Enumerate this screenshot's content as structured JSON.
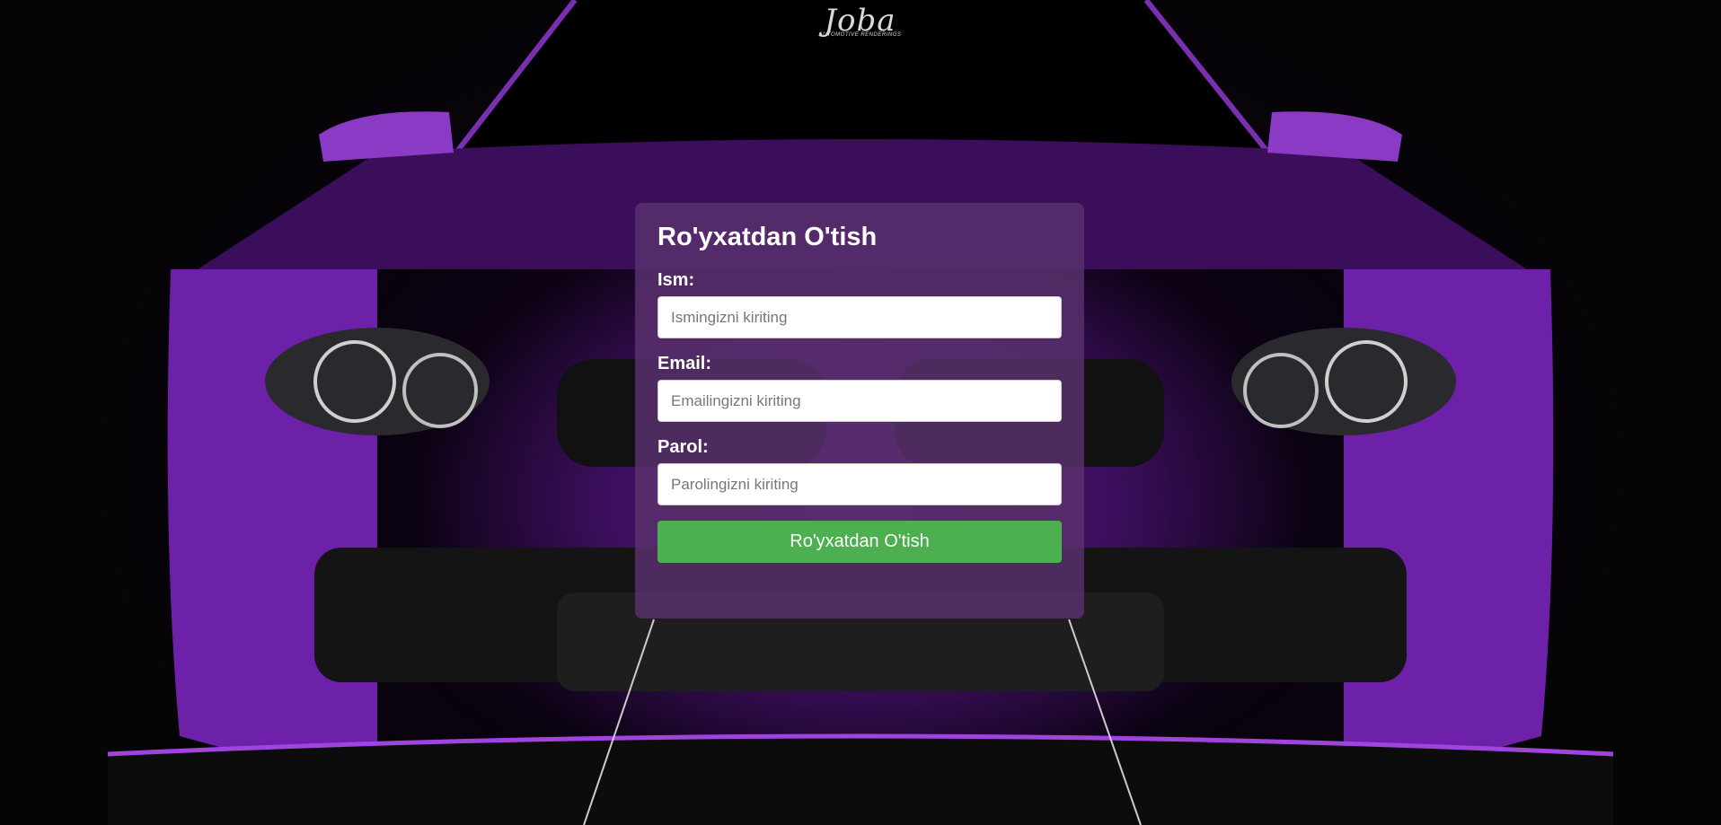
{
  "background": {
    "description_icon": "purple-car-front-image",
    "accent_color": "#6a1fa0"
  },
  "logo": {
    "mark": "Joba",
    "subtitle": "AUTOMOTIVE RENDERINGS"
  },
  "form": {
    "title": "Ro'yxatdan O'tish",
    "name_label": "Ism:",
    "name_placeholder": "Ismingizni kiriting",
    "email_label": "Email:",
    "email_placeholder": "Emailingizni kiriting",
    "password_label": "Parol:",
    "password_placeholder": "Parolingizni kiriting",
    "submit_label": "Ro'yxatdan O'tish",
    "submit_color": "#4caf50",
    "card_color": "#58306c"
  }
}
